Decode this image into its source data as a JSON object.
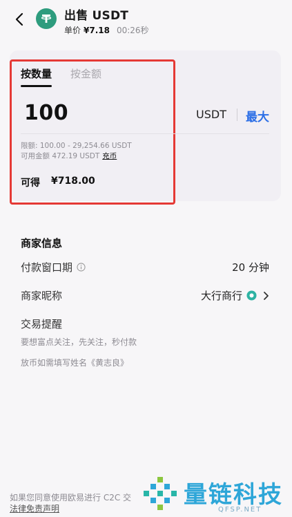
{
  "header": {
    "title": "出售 USDT",
    "price_label": "单价",
    "price_value": "¥7.18",
    "timer": "00:26秒"
  },
  "order_card": {
    "tabs": [
      {
        "label": "按数量",
        "active": true
      },
      {
        "label": "按金额",
        "active": false
      }
    ],
    "quantity": "100",
    "unit": "USDT",
    "max_label": "最大",
    "limit_text": "限额: 100.00 - 29,254.66 USDT",
    "available_text": "可用金额 472.19 USDT",
    "recharge_label": "充币",
    "receive_label": "可得",
    "receive_value": "¥718.00"
  },
  "merchant": {
    "section_title": "商家信息",
    "payment_window_label": "付款窗口期",
    "payment_window_value": "20 分钟",
    "nickname_label": "商家昵称",
    "nickname_value": "大行商行",
    "reminder_label": "交易提醒",
    "reminder_line1": "要想富点关注，先关注，秒付款",
    "reminder_line2": "放币如需填写姓名《黄志良》"
  },
  "footer": {
    "agreement_text": "如果您同意使用欧易进行 C2C 交",
    "disclaimer_link": "法律免责声明"
  },
  "watermark": {
    "name": "量链科技",
    "domain": "QFSP.NET"
  },
  "colors": {
    "accent_blue": "#2b6ee6",
    "tether_green": "#2e9c7e",
    "highlight_red": "#e53935",
    "watermark_blue": "#2ea6d8"
  }
}
